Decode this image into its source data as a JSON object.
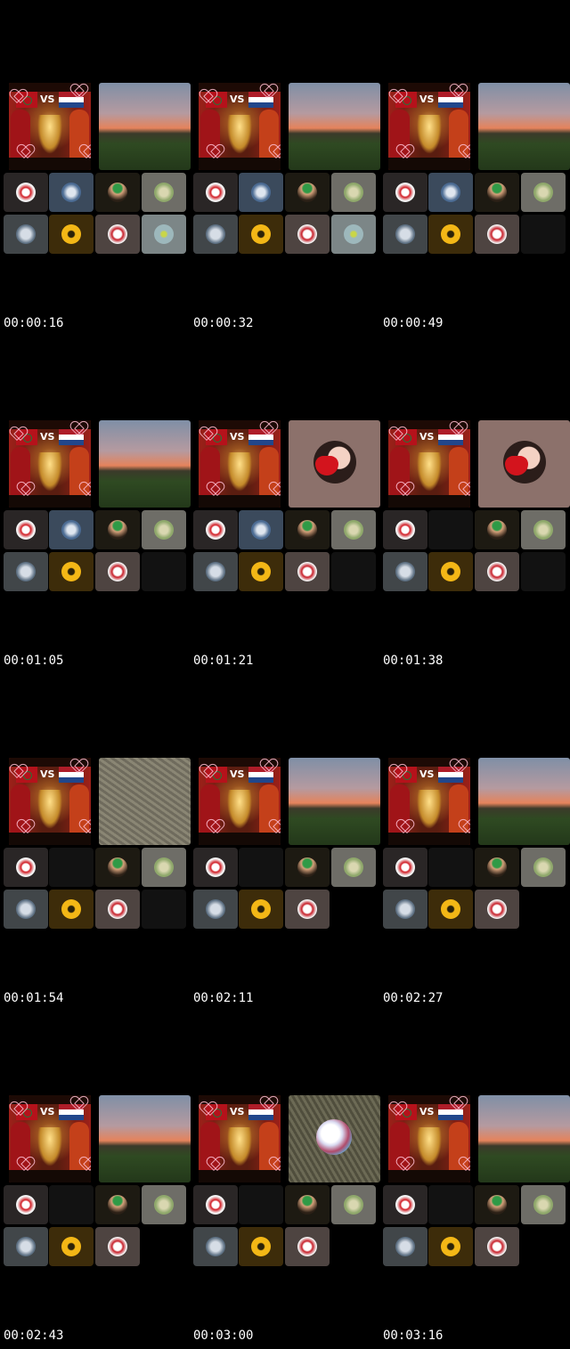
{
  "frames": [
    {
      "time": "00:00:16",
      "scene": "sunset",
      "row1": [
        "c-dark:d-red",
        "c-blue:d-earth",
        "c-olive:d-girl",
        "c-grey:d-green"
      ],
      "row2": [
        "c-slate:d-car",
        "c-amber:d-yellow",
        "c-mauve:d-flag",
        "c-pale:d-bee"
      ]
    },
    {
      "time": "00:00:32",
      "scene": "sunset",
      "row1": [
        "c-dark:d-red",
        "c-blue:d-earth",
        "c-olive:d-girl",
        "c-grey:d-green"
      ],
      "row2": [
        "c-slate:d-car",
        "c-amber:d-yellow",
        "c-mauve:d-flag",
        "c-pale:d-bee"
      ]
    },
    {
      "time": "00:00:49",
      "scene": "sunset",
      "row1": [
        "c-dark:d-red",
        "c-blue:d-earth",
        "c-olive:d-girl",
        "c-grey:d-green"
      ],
      "row2": [
        "c-slate:d-car",
        "c-amber:d-yellow",
        "c-mauve:d-flag",
        "c-empty:none"
      ]
    },
    {
      "time": "00:01:05",
      "scene": "sunset",
      "row1": [
        "c-dark:d-red",
        "c-blue:d-earth",
        "c-olive:d-girl",
        "c-grey:d-green"
      ],
      "row2": [
        "c-slate:d-car",
        "c-amber:d-yellow",
        "c-mauve:d-flag",
        "c-empty:none"
      ]
    },
    {
      "time": "00:01:21",
      "scene": "avatar",
      "row1": [
        "c-dark:d-red",
        "c-blue:d-earth",
        "c-olive:d-girl",
        "c-grey:d-green"
      ],
      "row2": [
        "c-slate:d-car",
        "c-amber:d-yellow",
        "c-mauve:d-flag",
        "c-empty:none"
      ]
    },
    {
      "time": "00:01:38",
      "scene": "avatar",
      "row1": [
        "c-dark:d-red",
        "c-empty:none",
        "c-olive:d-girl",
        "c-grey:d-green"
      ],
      "row2": [
        "c-slate:d-car",
        "c-amber:d-yellow",
        "c-mauve:d-flag",
        "c-empty:none"
      ]
    },
    {
      "time": "00:01:54",
      "scene": "grass",
      "row1": [
        "c-dark:d-red",
        "c-empty:none",
        "c-olive:d-girl",
        "c-grey:d-green"
      ],
      "row2": [
        "c-slate:d-car",
        "c-amber:d-yellow",
        "c-mauve:d-flag",
        "c-empty:none"
      ]
    },
    {
      "time": "00:02:11",
      "scene": "sunset",
      "row1": [
        "c-dark:d-red",
        "c-empty:none",
        "c-olive:d-girl",
        "c-grey:d-green"
      ],
      "row2": [
        "c-slate:d-car",
        "c-amber:d-yellow",
        "c-mauve:d-flag",
        "none"
      ]
    },
    {
      "time": "00:02:27",
      "scene": "sunset",
      "row1": [
        "c-dark:d-red",
        "c-empty:none",
        "c-olive:d-girl",
        "c-grey:d-green"
      ],
      "row2": [
        "c-slate:d-car",
        "c-amber:d-yellow",
        "c-mauve:d-flag",
        "none"
      ]
    },
    {
      "time": "00:02:43",
      "scene": "sunset",
      "row1": [
        "c-dark:d-red",
        "c-empty:none",
        "c-olive:d-girl",
        "c-grey:d-green"
      ],
      "row2": [
        "c-slate:d-car",
        "c-amber:d-yellow",
        "c-mauve:d-flag",
        "none"
      ]
    },
    {
      "time": "00:03:00",
      "scene": "ball",
      "row1": [
        "c-dark:d-red",
        "c-empty:none",
        "c-olive:d-girl",
        "c-grey:d-green"
      ],
      "row2": [
        "c-slate:d-car",
        "c-amber:d-yellow",
        "c-mauve:d-flag",
        "none"
      ]
    },
    {
      "time": "00:03:16",
      "scene": "sunset",
      "row1": [
        "c-dark:d-red",
        "c-empty:none",
        "c-olive:d-girl",
        "c-grey:d-green"
      ],
      "row2": [
        "c-slate:d-car",
        "c-amber:d-yellow",
        "c-mauve:d-flag",
        "none"
      ]
    }
  ],
  "poster": {
    "vs": "VS"
  },
  "colors": {
    "background": "#000000",
    "timestamp": "#ffffff"
  }
}
